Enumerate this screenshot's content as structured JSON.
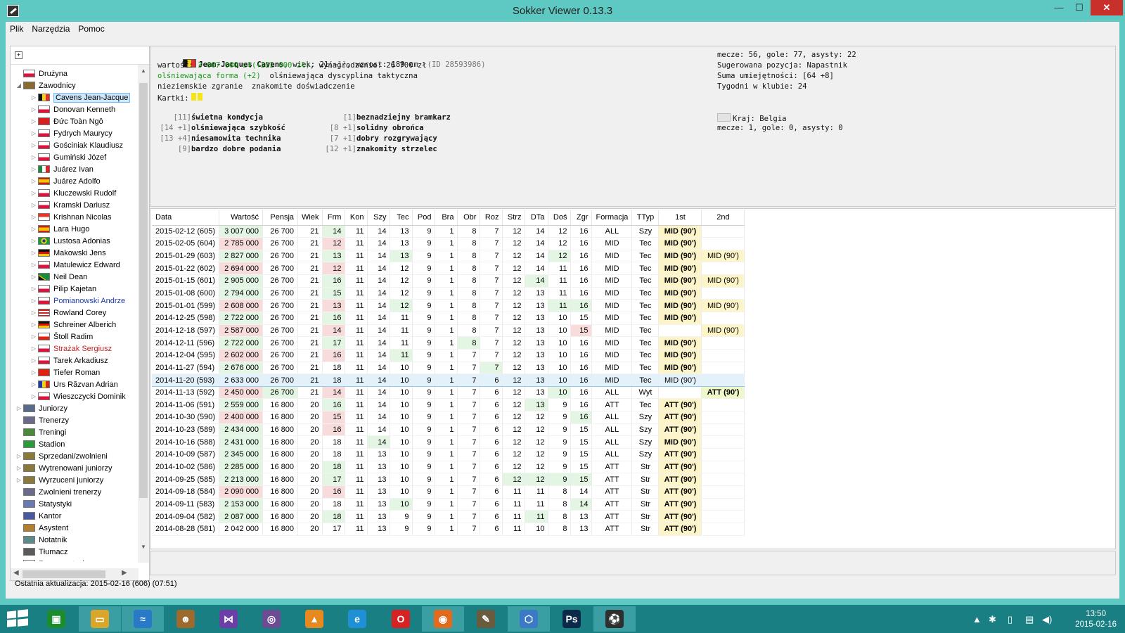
{
  "window": {
    "title": "Sokker Viewer 0.13.3",
    "minimize": "—",
    "maximize": "☐",
    "close": "✕"
  },
  "menu": [
    "Plik",
    "Narzędzia",
    "Pomoc"
  ],
  "tree": [
    {
      "label": "Drużyna",
      "indent": 1,
      "arrow": "",
      "icon": "flag-pl"
    },
    {
      "label": "Zawodnicy",
      "indent": 1,
      "arrow": "◢",
      "icon": "person-icon"
    },
    {
      "label": "Cavens Jean-Jacque",
      "indent": 2,
      "arrow": "▷",
      "icon": "flag-be",
      "selected": true
    },
    {
      "label": "Donovan Kenneth",
      "indent": 2,
      "arrow": "▷",
      "icon": "flag-pl"
    },
    {
      "label": "Đức Toàn Ngô",
      "indent": 2,
      "arrow": "▷",
      "icon": "flag-vn"
    },
    {
      "label": "Fydrych Maurycy",
      "indent": 2,
      "arrow": "▷",
      "icon": "flag-pl"
    },
    {
      "label": "Gościniak Klaudiusz",
      "indent": 2,
      "arrow": "▷",
      "icon": "flag-pl"
    },
    {
      "label": "Gumiński Józef",
      "indent": 2,
      "arrow": "▷",
      "icon": "flag-pl"
    },
    {
      "label": "Juárez Ivan",
      "indent": 2,
      "arrow": "▷",
      "icon": "flag-mx"
    },
    {
      "label": "Juárez Adolfo",
      "indent": 2,
      "arrow": "▷",
      "icon": "flag-es"
    },
    {
      "label": "Kluczewski Rudolf",
      "indent": 2,
      "arrow": "▷",
      "icon": "flag-pl"
    },
    {
      "label": "Kramski Dariusz",
      "indent": 2,
      "arrow": "▷",
      "icon": "flag-pl"
    },
    {
      "label": "Krishnan Nicolas",
      "indent": 2,
      "arrow": "▷",
      "icon": "flag-sg"
    },
    {
      "label": "Lara Hugo",
      "indent": 2,
      "arrow": "▷",
      "icon": "flag-es"
    },
    {
      "label": "Lustosa Adonias",
      "indent": 2,
      "arrow": "▷",
      "icon": "flag-br"
    },
    {
      "label": "Makowski Jens",
      "indent": 2,
      "arrow": "▷",
      "icon": "flag-de"
    },
    {
      "label": "Matulewicz Edward",
      "indent": 2,
      "arrow": "▷",
      "icon": "flag-pl"
    },
    {
      "label": "Neil Dean",
      "indent": 2,
      "arrow": "▷",
      "icon": "flag-jm"
    },
    {
      "label": "Pilip Kajetan",
      "indent": 2,
      "arrow": "▷",
      "icon": "flag-pl"
    },
    {
      "label": "Pomianowski Andrze",
      "indent": 2,
      "arrow": "▷",
      "icon": "flag-pl",
      "color": "blue"
    },
    {
      "label": "Rowland Corey",
      "indent": 2,
      "arrow": "▷",
      "icon": "flag-us"
    },
    {
      "label": "Schreiner Alberich",
      "indent": 2,
      "arrow": "▷",
      "icon": "flag-de"
    },
    {
      "label": "Štoll Radim",
      "indent": 2,
      "arrow": "▷",
      "icon": "flag-cz"
    },
    {
      "label": "Strażak Sergiusz",
      "indent": 2,
      "arrow": "▷",
      "icon": "flag-pl",
      "color": "red"
    },
    {
      "label": "Tarek Arkadiusz",
      "indent": 2,
      "arrow": "▷",
      "icon": "flag-pl"
    },
    {
      "label": "Tiefer Roman",
      "indent": 2,
      "arrow": "▷",
      "icon": "flag-ch"
    },
    {
      "label": "Urs Răzvan Adrian",
      "indent": 2,
      "arrow": "▷",
      "icon": "flag-ro"
    },
    {
      "label": "Wieszczycki Dominik",
      "indent": 2,
      "arrow": "▷",
      "icon": "flag-pl"
    },
    {
      "label": "Juniorzy",
      "indent": 1,
      "arrow": "▷",
      "icon": "junior-icon"
    },
    {
      "label": "Trenerzy",
      "indent": 1,
      "arrow": "",
      "icon": "whistle-icon"
    },
    {
      "label": "Treningi",
      "indent": 1,
      "arrow": "",
      "icon": "training-icon"
    },
    {
      "label": "Stadion",
      "indent": 1,
      "arrow": "",
      "icon": "stadium-icon"
    },
    {
      "label": "Sprzedani/zwolnieni",
      "indent": 1,
      "arrow": "▷",
      "icon": "transfer-icon"
    },
    {
      "label": "Wytrenowani juniorzy",
      "indent": 1,
      "arrow": "▷",
      "icon": "transfer-icon"
    },
    {
      "label": "Wyrzuceni juniorzy",
      "indent": 1,
      "arrow": "▷",
      "icon": "transfer-icon"
    },
    {
      "label": "Zwolnieni trenerzy",
      "indent": 1,
      "arrow": "",
      "icon": "whistle-icon"
    },
    {
      "label": "Statystyki",
      "indent": 1,
      "arrow": "",
      "icon": "stats-icon"
    },
    {
      "label": "Kantor",
      "indent": 1,
      "arrow": "",
      "icon": "exchange-icon"
    },
    {
      "label": "Asystent",
      "indent": 1,
      "arrow": "",
      "icon": "assistant-icon"
    },
    {
      "label": "Notatnik",
      "indent": 1,
      "arrow": "",
      "icon": "notebook-icon"
    },
    {
      "label": "Tłumacz",
      "indent": 1,
      "arrow": "",
      "icon": "translate-icon"
    },
    {
      "label": "Reprezentacja",
      "indent": 1,
      "arrow": "",
      "icon": "flag-pl"
    }
  ],
  "player": {
    "l1_name": "Jean-Jacques Cavens",
    "l1_wiek": ", wiek: 21",
    "l1_wiek_delta": "[+1]",
    "l1_wzrost": ", wzrost: 189 cm",
    "l1_id": "(ID 28593986)",
    "l2_prefix": "wartość: ",
    "l2_value": "3 007 000 zł(+222 000 zł)",
    "l2_wyn": ", wynagrodzenie: 26 700 zł",
    "l3_forma": "olśniewająca forma (+2)",
    "l3_dys": "olśniewająca dyscyplina taktyczna",
    "l4": "nieziemskie zgranie  znakomite doświadczenie",
    "l5": "Kartki:",
    "skills_left": [
      {
        "delta": "[11]",
        "label": "świetna kondycja"
      },
      {
        "delta": "[14 +1]",
        "label": "olśniewająca szybkość"
      },
      {
        "delta": "[13 +4]",
        "label": "niesamowita technika"
      },
      {
        "delta": "[9]",
        "label": "bardzo dobre podania"
      }
    ],
    "skills_right": [
      {
        "delta": "[1]",
        "label": "beznadziejny bramkarz"
      },
      {
        "delta": "[8 +1]",
        "label": "solidny obrońca"
      },
      {
        "delta": "[7 +1]",
        "label": "dobry rozgrywający"
      },
      {
        "delta": "[12 +1]",
        "label": "znakomity strzelec"
      }
    ],
    "right1": "mecze: 56, gole: 77, asysty: 22",
    "right2": "Sugerowana pozycja: Napastnik",
    "right3": "Suma umiejętności: [64 +8]",
    "right4": "Tygodni w klubie: 24",
    "country": "Kraj: Belgia",
    "country_stats": "mecze: 1, gole: 0, asysty: 0"
  },
  "table": {
    "headers": [
      "Data",
      "Wartość",
      "Pensja",
      "Wiek",
      "Frm",
      "Kon",
      "Szy",
      "Tec",
      "Pod",
      "Bra",
      "Obr",
      "Roz",
      "Strz",
      "DTa",
      "Doś",
      "Zgr",
      "Formacja",
      "TTyp",
      "1st",
      "2nd"
    ],
    "rows": [
      [
        "2015-02-12 (605)",
        "3 007 000",
        "26 700",
        "21",
        "14",
        "11",
        "14",
        "13",
        "9",
        "1",
        "8",
        "7",
        "12",
        "14",
        "12",
        "16",
        "ALL",
        "Szy",
        "MID (90')",
        ""
      ],
      [
        "2015-02-05 (604)",
        "2 785 000",
        "26 700",
        "21",
        "12",
        "11",
        "14",
        "13",
        "9",
        "1",
        "8",
        "7",
        "12",
        "14",
        "12",
        "16",
        "MID",
        "Tec",
        "MID (90')",
        ""
      ],
      [
        "2015-01-29 (603)",
        "2 827 000",
        "26 700",
        "21",
        "13",
        "11",
        "14",
        "13",
        "9",
        "1",
        "8",
        "7",
        "12",
        "14",
        "12",
        "16",
        "MID",
        "Tec",
        "MID (90')",
        "MID (90')"
      ],
      [
        "2015-01-22 (602)",
        "2 694 000",
        "26 700",
        "21",
        "12",
        "11",
        "14",
        "12",
        "9",
        "1",
        "8",
        "7",
        "12",
        "14",
        "11",
        "16",
        "MID",
        "Tec",
        "MID (90')",
        ""
      ],
      [
        "2015-01-15 (601)",
        "2 905 000",
        "26 700",
        "21",
        "16",
        "11",
        "14",
        "12",
        "9",
        "1",
        "8",
        "7",
        "12",
        "14",
        "11",
        "16",
        "MID",
        "Tec",
        "MID (90')",
        "MID (90')"
      ],
      [
        "2015-01-08 (600)",
        "2 794 000",
        "26 700",
        "21",
        "15",
        "11",
        "14",
        "12",
        "9",
        "1",
        "8",
        "7",
        "12",
        "13",
        "11",
        "16",
        "MID",
        "Tec",
        "MID (90')",
        ""
      ],
      [
        "2015-01-01 (599)",
        "2 608 000",
        "26 700",
        "21",
        "13",
        "11",
        "14",
        "12",
        "9",
        "1",
        "8",
        "7",
        "12",
        "13",
        "11",
        "16",
        "MID",
        "Tec",
        "MID (90')",
        "MID (90')"
      ],
      [
        "2014-12-25 (598)",
        "2 722 000",
        "26 700",
        "21",
        "16",
        "11",
        "14",
        "11",
        "9",
        "1",
        "8",
        "7",
        "12",
        "13",
        "10",
        "15",
        "MID",
        "Tec",
        "MID (90')",
        ""
      ],
      [
        "2014-12-18 (597)",
        "2 587 000",
        "26 700",
        "21",
        "14",
        "11",
        "14",
        "11",
        "9",
        "1",
        "8",
        "7",
        "12",
        "13",
        "10",
        "15",
        "MID",
        "Tec",
        "",
        "MID (90')"
      ],
      [
        "2014-12-11 (596)",
        "2 722 000",
        "26 700",
        "21",
        "17",
        "11",
        "14",
        "11",
        "9",
        "1",
        "8",
        "7",
        "12",
        "13",
        "10",
        "16",
        "MID",
        "Tec",
        "MID (90')",
        ""
      ],
      [
        "2014-12-04 (595)",
        "2 602 000",
        "26 700",
        "21",
        "16",
        "11",
        "14",
        "11",
        "9",
        "1",
        "7",
        "7",
        "12",
        "13",
        "10",
        "16",
        "MID",
        "Tec",
        "MID (90')",
        ""
      ],
      [
        "2014-11-27 (594)",
        "2 676 000",
        "26 700",
        "21",
        "18",
        "11",
        "14",
        "10",
        "9",
        "1",
        "7",
        "7",
        "12",
        "13",
        "10",
        "16",
        "MID",
        "Tec",
        "MID (90')",
        ""
      ],
      [
        "2014-11-20 (593)",
        "2 633 000",
        "26 700",
        "21",
        "18",
        "11",
        "14",
        "10",
        "9",
        "1",
        "7",
        "6",
        "12",
        "13",
        "10",
        "16",
        "MID",
        "Tec",
        "MID (90')",
        ""
      ],
      [
        "2014-11-13 (592)",
        "2 450 000",
        "26 700",
        "21",
        "14",
        "11",
        "14",
        "10",
        "9",
        "1",
        "7",
        "6",
        "12",
        "13",
        "10",
        "16",
        "ALL",
        "Wyt",
        "",
        "ATT (90')"
      ],
      [
        "2014-11-06 (591)",
        "2 559 000",
        "16 800",
        "20",
        "16",
        "11",
        "14",
        "10",
        "9",
        "1",
        "7",
        "6",
        "12",
        "13",
        "9",
        "16",
        "ATT",
        "Tec",
        "ATT (90')",
        ""
      ],
      [
        "2014-10-30 (590)",
        "2 400 000",
        "16 800",
        "20",
        "15",
        "11",
        "14",
        "10",
        "9",
        "1",
        "7",
        "6",
        "12",
        "12",
        "9",
        "16",
        "ALL",
        "Szy",
        "ATT (90')",
        ""
      ],
      [
        "2014-10-23 (589)",
        "2 434 000",
        "16 800",
        "20",
        "16",
        "11",
        "14",
        "10",
        "9",
        "1",
        "7",
        "6",
        "12",
        "12",
        "9",
        "15",
        "ALL",
        "Szy",
        "ATT (90')",
        ""
      ],
      [
        "2014-10-16 (588)",
        "2 431 000",
        "16 800",
        "20",
        "18",
        "11",
        "14",
        "10",
        "9",
        "1",
        "7",
        "6",
        "12",
        "12",
        "9",
        "15",
        "ALL",
        "Szy",
        "MID (90')",
        ""
      ],
      [
        "2014-10-09 (587)",
        "2 345 000",
        "16 800",
        "20",
        "18",
        "11",
        "13",
        "10",
        "9",
        "1",
        "7",
        "6",
        "12",
        "12",
        "9",
        "15",
        "ALL",
        "Szy",
        "ATT (90')",
        ""
      ],
      [
        "2014-10-02 (586)",
        "2 285 000",
        "16 800",
        "20",
        "18",
        "11",
        "13",
        "10",
        "9",
        "1",
        "7",
        "6",
        "12",
        "12",
        "9",
        "15",
        "ATT",
        "Str",
        "ATT (90')",
        ""
      ],
      [
        "2014-09-25 (585)",
        "2 213 000",
        "16 800",
        "20",
        "17",
        "11",
        "13",
        "10",
        "9",
        "1",
        "7",
        "6",
        "12",
        "12",
        "9",
        "15",
        "ATT",
        "Str",
        "ATT (90')",
        ""
      ],
      [
        "2014-09-18 (584)",
        "2 090 000",
        "16 800",
        "20",
        "16",
        "11",
        "13",
        "10",
        "9",
        "1",
        "7",
        "6",
        "11",
        "11",
        "8",
        "14",
        "ATT",
        "Str",
        "ATT (90')",
        ""
      ],
      [
        "2014-09-11 (583)",
        "2 153 000",
        "16 800",
        "20",
        "18",
        "11",
        "13",
        "10",
        "9",
        "1",
        "7",
        "6",
        "11",
        "11",
        "8",
        "14",
        "ATT",
        "Str",
        "ATT (90')",
        ""
      ],
      [
        "2014-09-04 (582)",
        "2 087 000",
        "16 800",
        "20",
        "18",
        "11",
        "13",
        "9",
        "9",
        "1",
        "7",
        "6",
        "11",
        "11",
        "8",
        "13",
        "ATT",
        "Str",
        "ATT (90')",
        ""
      ],
      [
        "2014-08-28 (581)",
        "2 042 000",
        "16 800",
        "20",
        "17",
        "11",
        "13",
        "9",
        "9",
        "1",
        "7",
        "6",
        "11",
        "10",
        "8",
        "13",
        "ATT",
        "Str",
        "ATT (90')",
        ""
      ]
    ],
    "selected_row": 12
  },
  "status": "Ostatnia aktualizacja: 2015-02-16 (606) (07:51)",
  "taskbar": {
    "apps": [
      {
        "name": "store-icon",
        "glyph": "▣",
        "color": "#1c8c2e"
      },
      {
        "name": "file-explorer-icon",
        "glyph": "▭",
        "color": "#d9a62a"
      },
      {
        "name": "browser-app-icon",
        "glyph": "≈",
        "color": "#2a78c8"
      },
      {
        "name": "boxing-app-icon",
        "glyph": "☻",
        "color": "#9c6a2c"
      },
      {
        "name": "visual-studio-icon",
        "glyph": "⋈",
        "color": "#6c3fa8"
      },
      {
        "name": "screenshot-app-icon",
        "glyph": "◎",
        "color": "#6d4c93"
      },
      {
        "name": "avast-icon",
        "glyph": "▲",
        "color": "#e68a1f"
      },
      {
        "name": "internet-explorer-icon",
        "glyph": "e",
        "color": "#1f8fd6"
      },
      {
        "name": "opera-icon",
        "glyph": "O",
        "color": "#d62222"
      },
      {
        "name": "firefox-icon",
        "glyph": "◉",
        "color": "#e26a1c"
      },
      {
        "name": "gimp-icon",
        "glyph": "✎",
        "color": "#6b5b3e"
      },
      {
        "name": "virtualbox-icon",
        "glyph": "⬡",
        "color": "#3c79c4"
      },
      {
        "name": "photoshop-icon",
        "glyph": "Ps",
        "color": "#0b2a4a"
      },
      {
        "name": "sokker-viewer-icon",
        "glyph": "⚽",
        "color": "#2f2f2f"
      }
    ],
    "time": "13:50",
    "date": "2015-02-16"
  }
}
